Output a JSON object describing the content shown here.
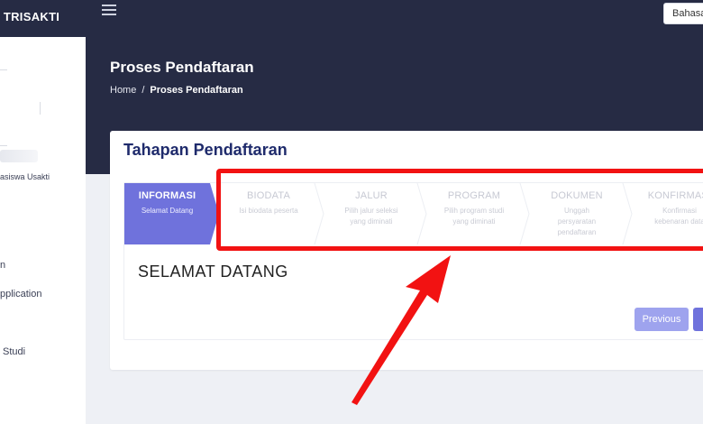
{
  "brand": {
    "name": "S TRISAKTI"
  },
  "sidebar": {
    "profile_subtitle": "asiswa Usakti",
    "items": [
      {
        "label": "n"
      },
      {
        "label": "pplication"
      },
      {
        "label": "Studi"
      }
    ]
  },
  "topbar": {
    "language_label": "Bahasa"
  },
  "header": {
    "title": "Proses Pendaftaran",
    "breadcrumb": {
      "home": "Home",
      "separator": "/",
      "current": "Proses Pendaftaran"
    }
  },
  "card": {
    "title": "Tahapan Pendaftaran",
    "steps": [
      {
        "label": "INFORMASI",
        "sub": "Selamat Datang",
        "active": true
      },
      {
        "label": "BIODATA",
        "sub": "Isi biodata peserta",
        "active": false
      },
      {
        "label": "JALUR",
        "sub": "Pilih jalur seleksi yang diminati",
        "active": false
      },
      {
        "label": "PROGRAM",
        "sub": "Pilih program studi yang diminati",
        "active": false
      },
      {
        "label": "DOKUMEN",
        "sub": "Unggah persyaratan pendaftaran",
        "active": false
      },
      {
        "label": "KONFIRMASI",
        "sub": "Konfirmasi kebenaran data",
        "active": false
      }
    ],
    "welcome": "SELAMAT DATANG",
    "prev_button": "Previous"
  },
  "colors": {
    "navy": "#262b44",
    "active_step": "#6f72dc",
    "title_blue": "#1f2b6c",
    "annotation_red": "#f21212"
  }
}
